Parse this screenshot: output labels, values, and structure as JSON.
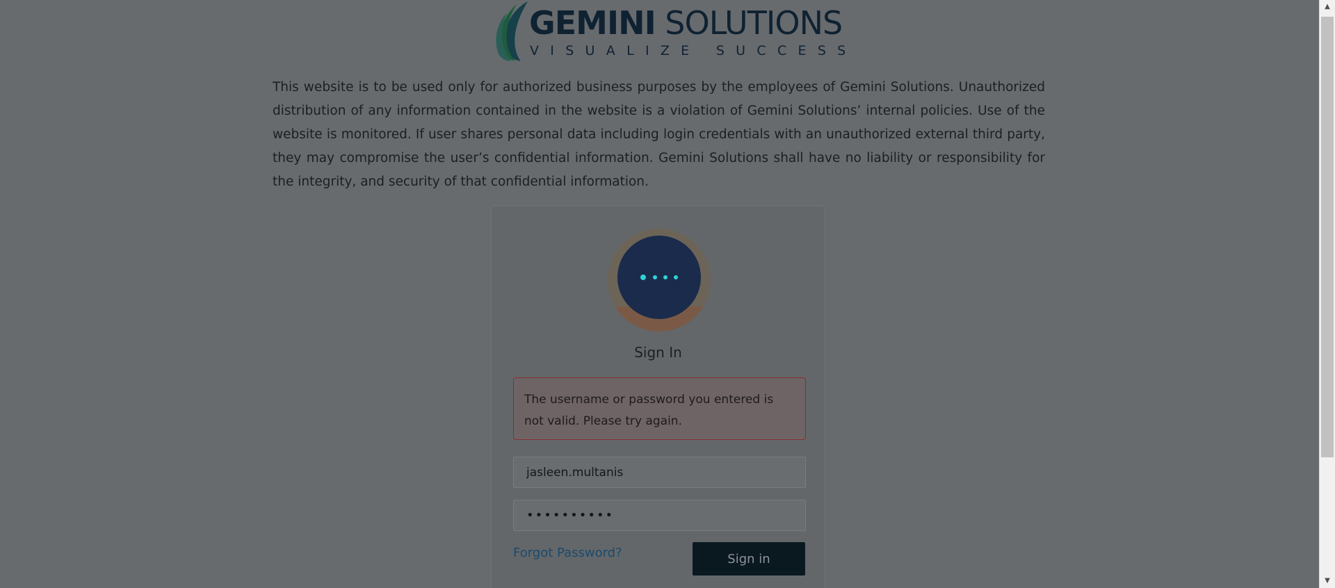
{
  "logo": {
    "brand_part1": "GEMINI",
    "brand_part2": " SOLUTIONS",
    "tagline": "VISUALIZE SUCCESS",
    "icon": "leaf-logo-icon"
  },
  "disclaimer": "This website is to be used only for authorized business purposes by the employees of Gemini Solutions. Unauthorized distribution of any information contained in the website is a violation of Gemini Solutions’ internal policies. Use of the website is monitored. If user shares personal data including login credentials with an unauthorized external third party, they may compromise the user’s confidential information. Gemini Solutions shall have no liability or responsibility for the integrity, and security of that confidential information.",
  "login": {
    "avatar_icon": "loading-dots-icon",
    "title": "Sign In",
    "error_message": "The username or password you entered is not valid. Please try again.",
    "username_value": "jasleen.multanis",
    "password_value": "••••••••••",
    "forgot_label": "Forgot Password?",
    "submit_label": "Sign in"
  },
  "colors": {
    "overlay": "#686b6e",
    "brand_navy": "#0f2232",
    "loader_cyan": "#2fd3d6",
    "error_border": "#8a2d2d",
    "button_bg": "#0a1820"
  },
  "scrollbar": {
    "up_icon": "scroll-up-arrow-icon",
    "down_icon": "scroll-down-arrow-icon"
  }
}
